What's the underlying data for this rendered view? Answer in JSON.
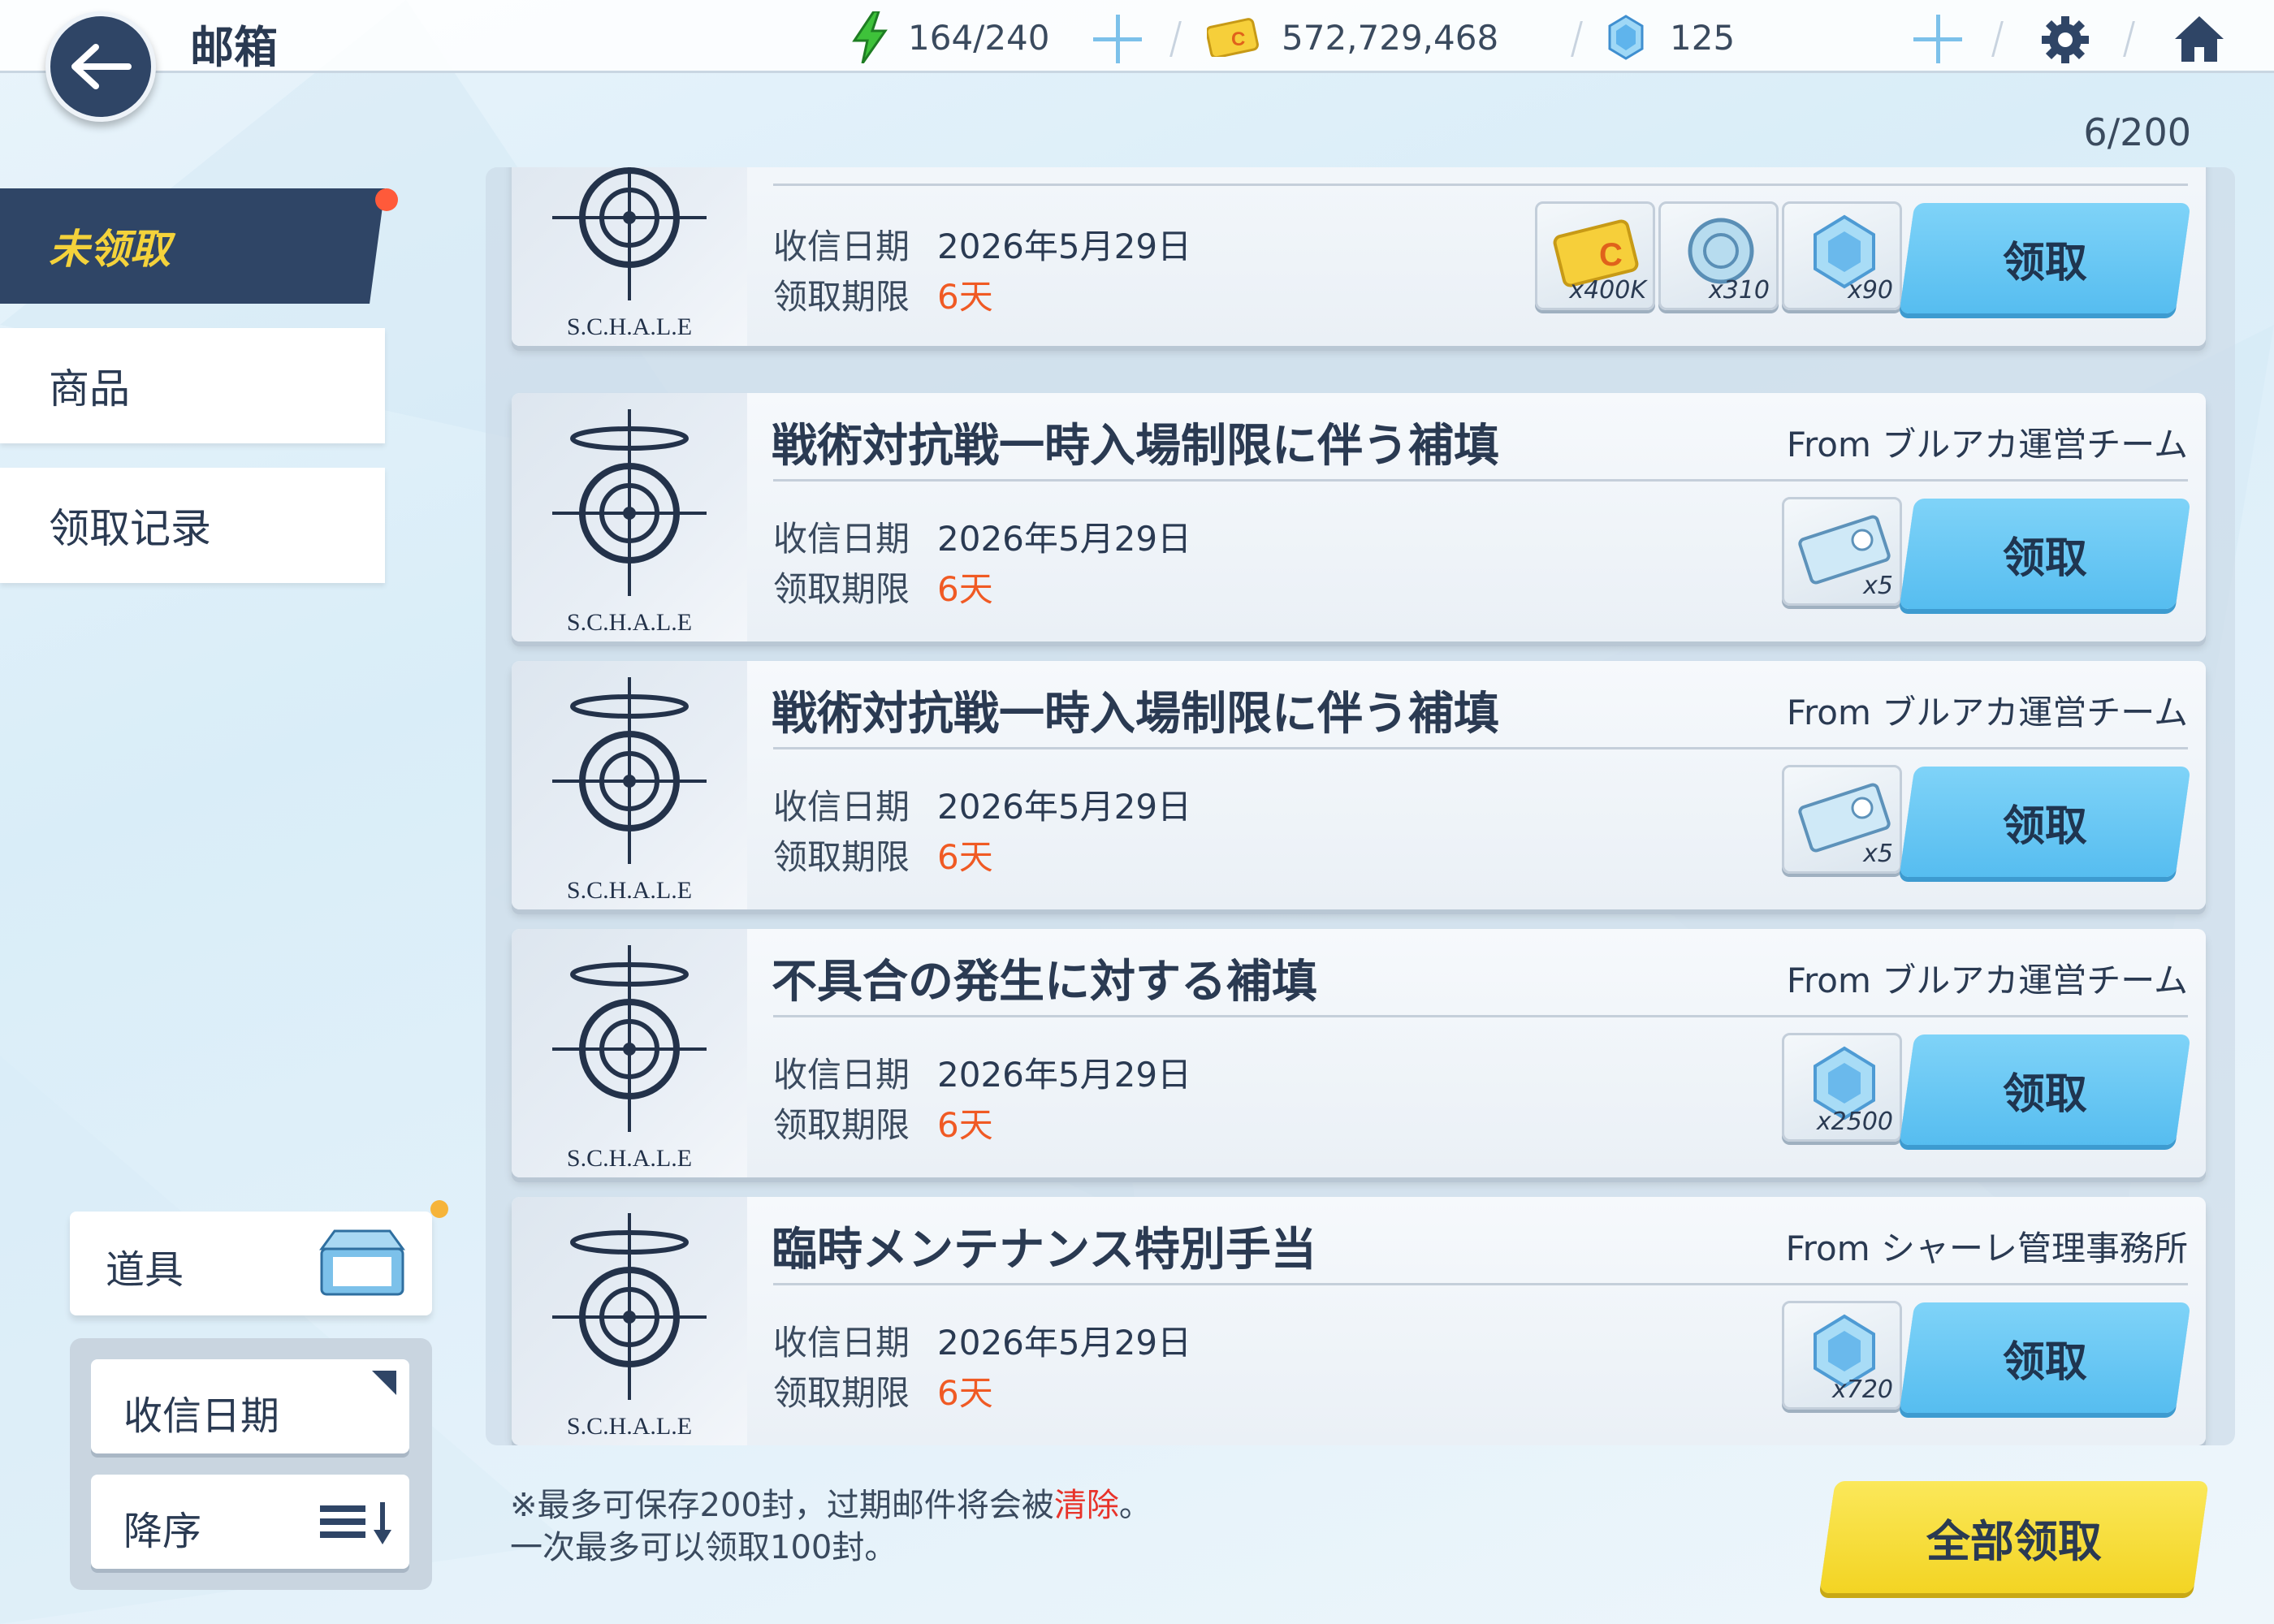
{
  "header": {
    "title": "邮箱",
    "ap": "164/240",
    "credits": "572,729,468",
    "gems": "125"
  },
  "mail_count": "6/200",
  "sidebar": {
    "items": [
      {
        "label": "未领取"
      },
      {
        "label": "商品"
      },
      {
        "label": "领取记录"
      }
    ]
  },
  "filters": {
    "items_label": "道具",
    "sort_field": "收信日期",
    "sort_order": "降序"
  },
  "mail_labels": {
    "received": "收信日期",
    "deadline": "领取期限",
    "claim": "领取",
    "emblem": "S.C.H.A.L.E"
  },
  "mails": [
    {
      "title": "",
      "from": "",
      "date": "2026年5月29日",
      "expires": "6天",
      "rewards": [
        {
          "icon": "credit-card-icon",
          "qty": "x400K"
        },
        {
          "icon": "enhancement-stone-icon",
          "qty": "x310"
        },
        {
          "icon": "pyroxene-icon",
          "qty": "x90"
        }
      ]
    },
    {
      "title": "戦術対抗戦一時入場制限に伴う補填",
      "from": "From ブルアカ運営チーム",
      "date": "2026年5月29日",
      "expires": "6天",
      "rewards": [
        {
          "icon": "ticket-icon",
          "qty": "x5"
        }
      ]
    },
    {
      "title": "戦術対抗戦一時入場制限に伴う補填",
      "from": "From ブルアカ運営チーム",
      "date": "2026年5月29日",
      "expires": "6天",
      "rewards": [
        {
          "icon": "ticket-icon",
          "qty": "x5"
        }
      ]
    },
    {
      "title": "不具合の発生に対する補填",
      "from": "From ブルアカ運営チーム",
      "date": "2026年5月29日",
      "expires": "6天",
      "rewards": [
        {
          "icon": "pyroxene-icon",
          "qty": "x2500"
        }
      ]
    },
    {
      "title": "臨時メンテナンス特別手当",
      "from": "From シャーレ管理事務所",
      "date": "2026年5月29日",
      "expires": "6天",
      "rewards": [
        {
          "icon": "pyroxene-icon",
          "qty": "x720"
        }
      ]
    }
  ],
  "note": {
    "line1_a": "※最多可保存200封，过期邮件将会被",
    "line1_red": "清除",
    "line1_b": "。",
    "line2": "一次最多可以领取100封。"
  },
  "claim_all_label": "全部领取",
  "colors": {
    "accent_blue": "#56bdf0",
    "claim_all_yellow": "#f3d423",
    "nav_dark": "#2f4566",
    "expire_red": "#f05a24"
  }
}
